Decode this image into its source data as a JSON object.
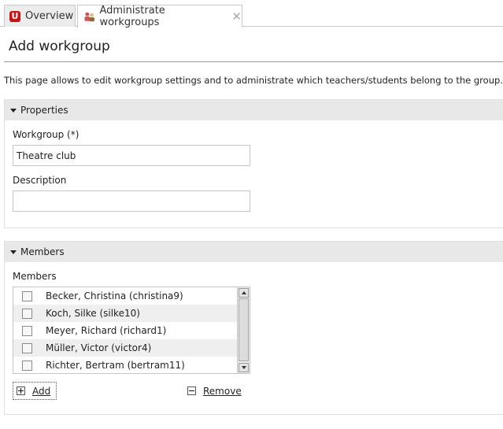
{
  "tabs": [
    {
      "label": "Overview",
      "icon": "untis-logo-icon",
      "logo_letter": "U"
    },
    {
      "label": "Administrate workgroups",
      "icon": "people-icon",
      "close": "✕"
    }
  ],
  "page": {
    "title": "Add workgroup",
    "intro": "This page allows to edit workgroup settings and to administrate which teachers/students belong to the group."
  },
  "properties": {
    "header": "Properties",
    "workgroup_label": "Workgroup (*)",
    "workgroup_value": "Theatre club",
    "description_label": "Description",
    "description_value": ""
  },
  "members": {
    "header": "Members",
    "list_label": "Members",
    "items": [
      {
        "name": "Becker, Christina (christina9)"
      },
      {
        "name": "Koch, Silke (silke10)"
      },
      {
        "name": "Meyer, Richard (richard1)"
      },
      {
        "name": "Müller, Victor (victor4)"
      },
      {
        "name": "Richter, Bertram (bertram11)"
      }
    ],
    "add_label": "Add",
    "remove_label": "Remove"
  },
  "colors": {
    "logo_red": "#c81414",
    "section_header_bg": "#e8e8e8"
  }
}
